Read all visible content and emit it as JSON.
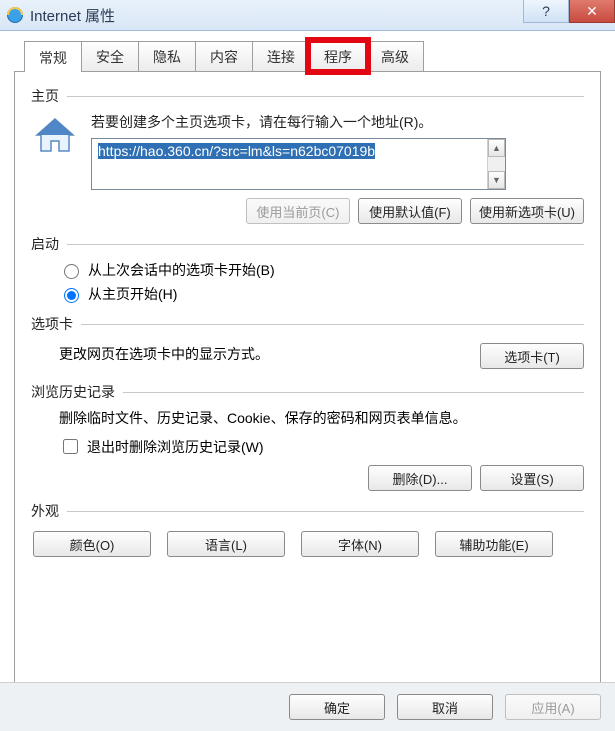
{
  "window": {
    "title": "Internet 属性",
    "help_glyph": "?",
    "close_glyph": "✕"
  },
  "tabs": {
    "general": "常规",
    "security": "安全",
    "privacy": "隐私",
    "content": "内容",
    "connections": "连接",
    "programs": "程序",
    "advanced": "高级"
  },
  "homepage": {
    "group_label": "主页",
    "instruction": "若要创建多个主页选项卡，请在每行输入一个地址(R)。",
    "url": "https://hao.360.cn/?src=lm&ls=n62bc07019b",
    "btn_current": "使用当前页(C)",
    "btn_default": "使用默认值(F)",
    "btn_newtab": "使用新选项卡(U)"
  },
  "startup": {
    "group_label": "启动",
    "opt_last_session": "从上次会话中的选项卡开始(B)",
    "opt_home": "从主页开始(H)"
  },
  "tabs_section": {
    "group_label": "选项卡",
    "desc": "更改网页在选项卡中的显示方式。",
    "btn_tabs": "选项卡(T)"
  },
  "history": {
    "group_label": "浏览历史记录",
    "desc": "删除临时文件、历史记录、Cookie、保存的密码和网页表单信息。",
    "chk_delete_on_exit": "退出时删除浏览历史记录(W)",
    "btn_delete": "删除(D)...",
    "btn_settings": "设置(S)"
  },
  "appearance": {
    "group_label": "外观",
    "btn_colors": "颜色(O)",
    "btn_languages": "语言(L)",
    "btn_fonts": "字体(N)",
    "btn_accessibility": "辅助功能(E)"
  },
  "footer": {
    "ok": "确定",
    "cancel": "取消",
    "apply": "应用(A)"
  }
}
